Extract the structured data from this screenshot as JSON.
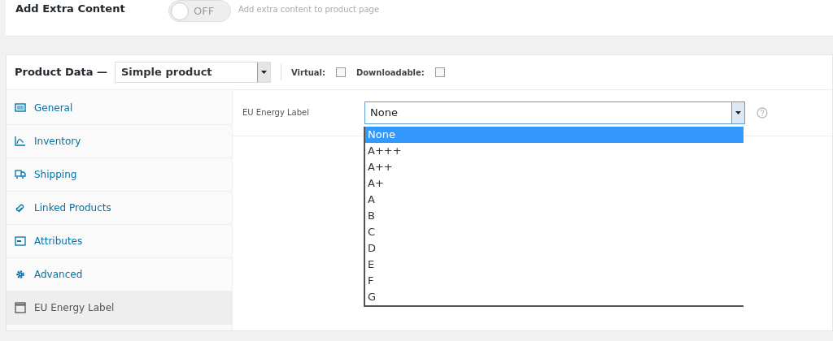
{
  "extra_content": {
    "label": "Add Extra Content",
    "toggle": {
      "on": false,
      "label": "OFF"
    },
    "hint": "Add extra content to product page"
  },
  "product_data": {
    "title": "Product Data —",
    "type_select": {
      "value": "Simple product"
    },
    "options": [
      {
        "label": "Virtual:",
        "checked": false
      },
      {
        "label": "Downloadable:",
        "checked": false
      }
    ],
    "tabs": [
      {
        "label": "General",
        "selected": false
      },
      {
        "label": "Inventory",
        "selected": false
      },
      {
        "label": "Shipping",
        "selected": false
      },
      {
        "label": "Linked Products",
        "selected": false
      },
      {
        "label": "Attributes",
        "selected": false
      },
      {
        "label": "Advanced",
        "selected": false
      },
      {
        "label": "EU Energy Label",
        "selected": true
      }
    ],
    "field": {
      "label": "EU Energy Label",
      "value": "None",
      "dropdown": [
        {
          "label": "None",
          "selected": true
        },
        {
          "label": "A+++",
          "selected": false
        },
        {
          "label": "A++",
          "selected": false
        },
        {
          "label": "A+",
          "selected": false
        },
        {
          "label": "A",
          "selected": false
        },
        {
          "label": "B",
          "selected": false
        },
        {
          "label": "C",
          "selected": false
        },
        {
          "label": "D",
          "selected": false
        },
        {
          "label": "E",
          "selected": false
        },
        {
          "label": "F",
          "selected": false
        },
        {
          "label": "G",
          "selected": false
        }
      ]
    }
  }
}
